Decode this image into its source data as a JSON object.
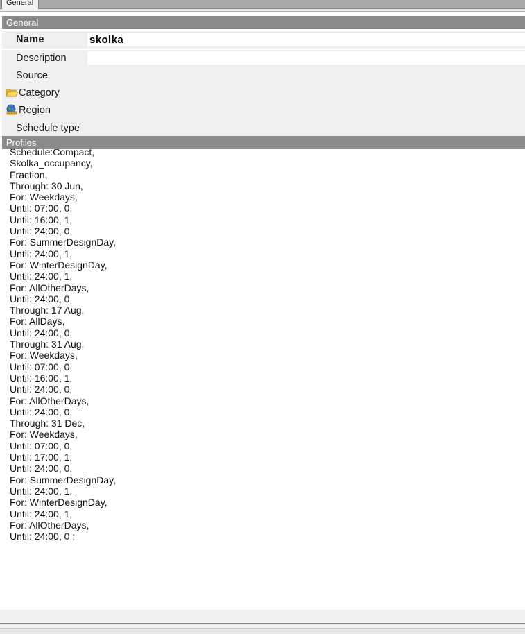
{
  "tabs": [
    {
      "label": "General",
      "active": true
    }
  ],
  "general_section": {
    "header": "General",
    "name_label": "Name",
    "name_value": "skolka",
    "description_label": "Description",
    "description_value": "",
    "source_label": "Source",
    "category_label": "Category",
    "category_icon": "folder-icon",
    "region_label": "Region",
    "region_icon": "globe-region-icon",
    "schedule_type_label": "Schedule type"
  },
  "profiles_section": {
    "header": "Profiles",
    "lines": [
      "Schedule:Compact,",
      "Skolka_occupancy,",
      "Fraction,",
      "Through: 30 Jun,",
      "For: Weekdays,",
      "Until: 07:00, 0,",
      "Until: 16:00, 1,",
      "Until: 24:00, 0,",
      "For: SummerDesignDay,",
      "Until: 24:00, 1,",
      "For: WinterDesignDay,",
      "Until: 24:00, 1,",
      "For: AllOtherDays,",
      "Until: 24:00, 0,",
      "Through: 17 Aug,",
      "For: AllDays,",
      "Until: 24:00, 0,",
      "Through: 31 Aug,",
      "For: Weekdays,",
      "Until: 07:00, 0,",
      "Until: 16:00, 1,",
      "Until: 24:00, 0,",
      "For: AllOtherDays,",
      "Until: 24:00, 0,",
      "Through: 31 Dec,",
      "For: Weekdays,",
      "Until: 07:00, 0,",
      "Until: 17:00, 1,",
      "Until: 24:00, 0,",
      "For: SummerDesignDay,",
      "Until: 24:00, 1,",
      "For: WinterDesignDay,",
      "Until: 24:00, 1,",
      "For: AllOtherDays,",
      "Until: 24:00, 0 ;"
    ]
  },
  "colors": {
    "section_header_bg": "#8a8a8a",
    "row_bg": "#f0f0f0",
    "field_bg": "#ffffff",
    "folder_yellow": "#f2c53d",
    "region_blue": "#3b6fd1"
  }
}
